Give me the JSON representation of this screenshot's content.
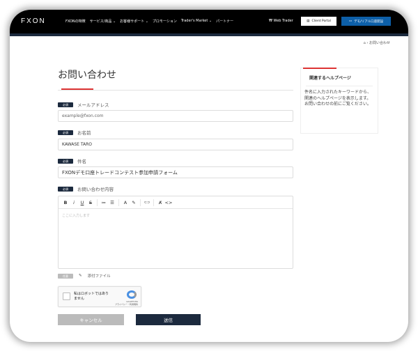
{
  "header": {
    "logo": "FXON",
    "nav": [
      "FXONの特徴",
      "サービス/商品 ⌄",
      "お客様サポート ⌄",
      "プロモーション",
      "Trader's Market ⌄",
      "パートナー"
    ],
    "web_trader": "Web Trader",
    "client_portal": "Client Portal",
    "demo_button": "デモ/リアル口座開設"
  },
  "breadcrumb": {
    "current": "お問い合わせ"
  },
  "page_title": "お問い合わせ",
  "form": {
    "required": "必須",
    "optional": "任意",
    "email": {
      "label": "メールアドレス",
      "placeholder": "example@fxon.com"
    },
    "name": {
      "label": "お名前",
      "value": "KAWASE TARO"
    },
    "subject": {
      "label": "件名",
      "value": "FXONデモ口座トレードコンテスト参加申請フォーム"
    },
    "content": {
      "label": "お問い合わせ内容",
      "placeholder": "ここに入力します"
    },
    "toolbar": [
      "B",
      "i",
      "U",
      "S",
      "≔",
      "☰",
      "A",
      "✎",
      "⊂⊃",
      "Ⱥ",
      "<>"
    ],
    "attachment": "添付ファイル",
    "captcha": {
      "text": "私はロボットではありません",
      "brand": "reCAPTCHA",
      "links": "プライバシー・利用規約"
    },
    "cancel": "キャンセル",
    "submit": "送信"
  },
  "sidebar": {
    "title": "関連するヘルプページ",
    "text": "件名に入力されたキーワードから、関連のヘルプページを表示します。\nお問い合わせの前にご覧ください。"
  }
}
